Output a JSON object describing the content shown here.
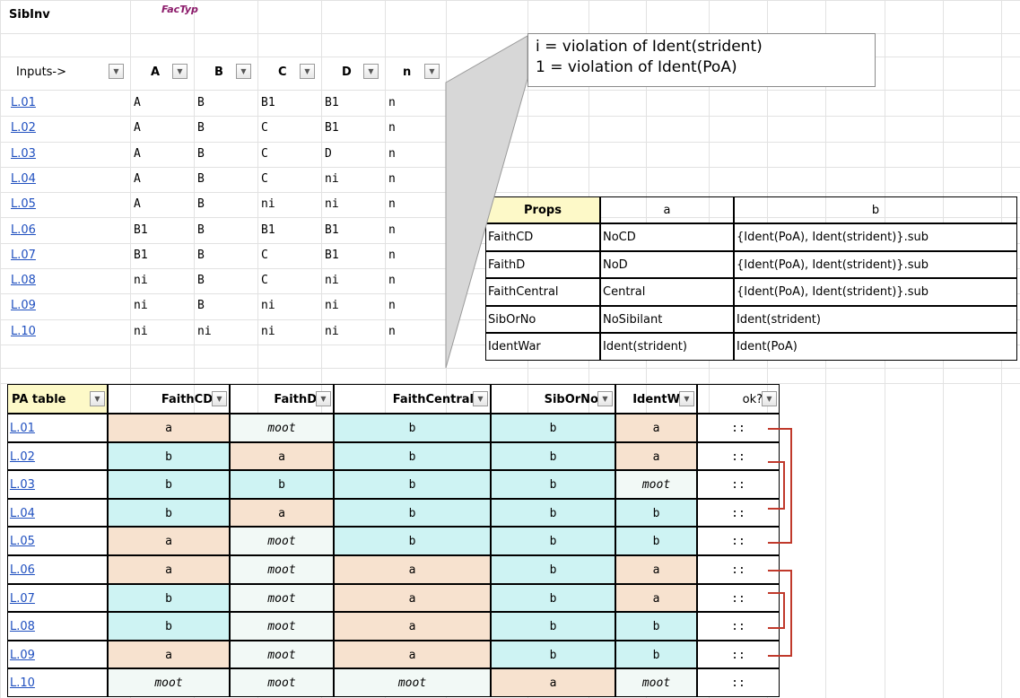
{
  "sibinv": {
    "title": "SibInv",
    "factyp": "FacTyp",
    "headers": [
      "Inputs->",
      "A",
      "B",
      "C",
      "D",
      "n"
    ],
    "rows": [
      [
        "L.01",
        "A",
        "B",
        "B1",
        "B1",
        "n"
      ],
      [
        "L.02",
        "A",
        "B",
        "C",
        "B1",
        "n"
      ],
      [
        "L.03",
        "A",
        "B",
        "C",
        "D",
        "n"
      ],
      [
        "L.04",
        "A",
        "B",
        "C",
        "ni",
        "n"
      ],
      [
        "L.05",
        "A",
        "B",
        "ni",
        "ni",
        "n"
      ],
      [
        "L.06",
        "B1",
        "B",
        "B1",
        "B1",
        "n"
      ],
      [
        "L.07",
        "B1",
        "B",
        "C",
        "B1",
        "n"
      ],
      [
        "L.08",
        "ni",
        "B",
        "C",
        "ni",
        "n"
      ],
      [
        "L.09",
        "ni",
        "B",
        "ni",
        "ni",
        "n"
      ],
      [
        "L.10",
        "ni",
        "ni",
        "ni",
        "ni",
        "n"
      ]
    ]
  },
  "note": {
    "line1": "i  = violation of Ident(strident)",
    "line2": "1 = violation of Ident(PoA)"
  },
  "props": {
    "headers": [
      "Props",
      "a",
      "b"
    ],
    "rows": [
      [
        "FaithCD",
        "NoCD",
        "{Ident(PoA), Ident(strident)}.sub"
      ],
      [
        "FaithD",
        "NoD",
        "{Ident(PoA), Ident(strident)}.sub"
      ],
      [
        "FaithCentral",
        "Central",
        "{Ident(PoA), Ident(strident)}.sub"
      ],
      [
        "SibOrNo",
        "NoSibilant",
        "Ident(strident)"
      ],
      [
        "IdentWar",
        "Ident(strident)",
        "Ident(PoA)"
      ]
    ]
  },
  "pa": {
    "headers": [
      "PA table",
      "FaithCD",
      "FaithD",
      "FaithCentral",
      "SibOrNo",
      "IdentW",
      "ok?"
    ],
    "rows": [
      [
        "L.01",
        "a",
        "moot",
        "b",
        "b",
        "a",
        "::"
      ],
      [
        "L.02",
        "b",
        "a",
        "b",
        "b",
        "a",
        "::"
      ],
      [
        "L.03",
        "b",
        "b",
        "b",
        "b",
        "moot",
        "::"
      ],
      [
        "L.04",
        "b",
        "a",
        "b",
        "b",
        "b",
        "::"
      ],
      [
        "L.05",
        "a",
        "moot",
        "b",
        "b",
        "b",
        "::"
      ],
      [
        "L.06",
        "a",
        "moot",
        "a",
        "b",
        "a",
        "::"
      ],
      [
        "L.07",
        "b",
        "moot",
        "a",
        "b",
        "a",
        "::"
      ],
      [
        "L.08",
        "b",
        "moot",
        "a",
        "b",
        "b",
        "::"
      ],
      [
        "L.09",
        "a",
        "moot",
        "a",
        "b",
        "b",
        "::"
      ],
      [
        "L.10",
        "moot",
        "moot",
        "moot",
        "a",
        "moot",
        "::"
      ]
    ]
  },
  "colors": {
    "link": "#1f4fbf",
    "cyan": "#cef3f3",
    "peach": "#f7e2cf",
    "mint": "#f2f9f6",
    "props_header": "#fdf9c8",
    "bracket": "#c0392b",
    "gridline": "#e2e2e2"
  }
}
